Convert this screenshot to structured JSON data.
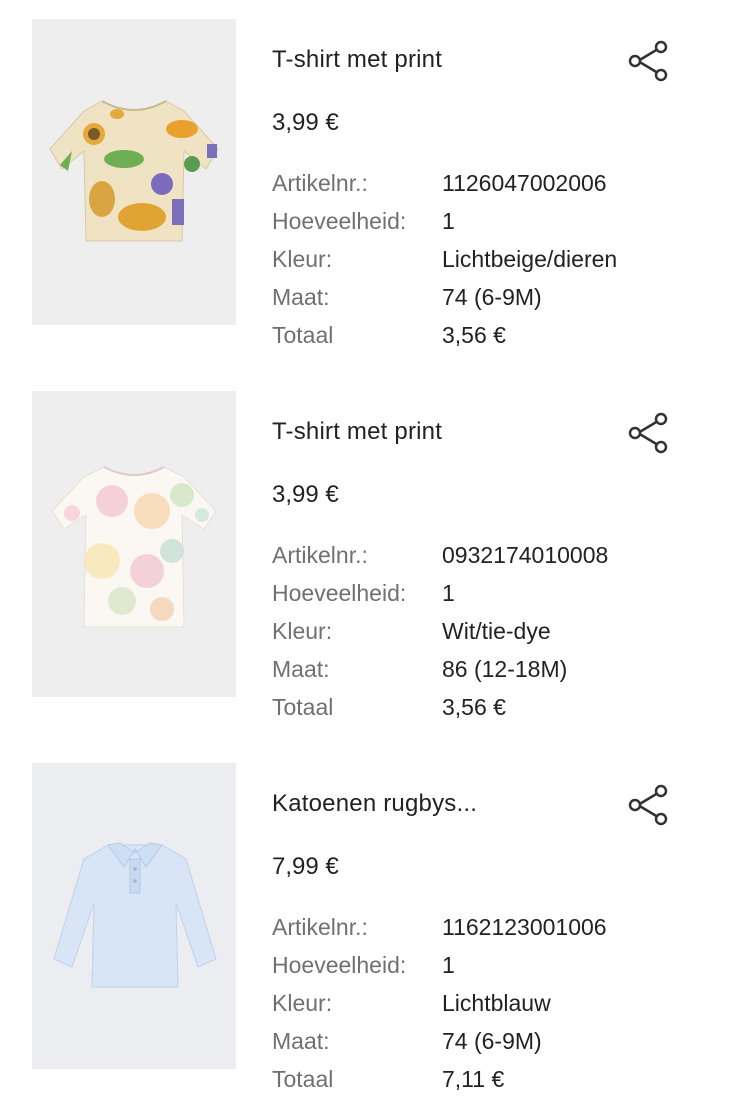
{
  "labels": {
    "article_no": "Artikelnr.:",
    "quantity": "Hoeveelheid:",
    "color": "Kleur:",
    "size": "Maat:",
    "total": "Totaal"
  },
  "items": [
    {
      "name": "T-shirt met print",
      "price": "3,99 €",
      "article_no": "1126047002006",
      "quantity": "1",
      "color": "Lichtbeige/dieren",
      "size": "74 (6-9M)",
      "total": "3,56 €",
      "image": "animal-print-tshirt-image"
    },
    {
      "name": "T-shirt met print",
      "price": "3,99 €",
      "article_no": "0932174010008",
      "quantity": "1",
      "color": "Wit/tie-dye",
      "size": "86 (12-18M)",
      "total": "3,56 €",
      "image": "tie-dye-tshirt-image"
    },
    {
      "name": "Katoenen rugbys...",
      "price": "7,99 €",
      "article_no": "1162123001006",
      "quantity": "1",
      "color": "Lichtblauw",
      "size": "74 (6-9M)",
      "total": "7,11 €",
      "image": "light-blue-rugby-shirt-image"
    }
  ],
  "icons": {
    "share": "share-icon"
  },
  "colors": {
    "text": "#222222",
    "label": "#707070",
    "thumb_bg": "#efeeee"
  }
}
